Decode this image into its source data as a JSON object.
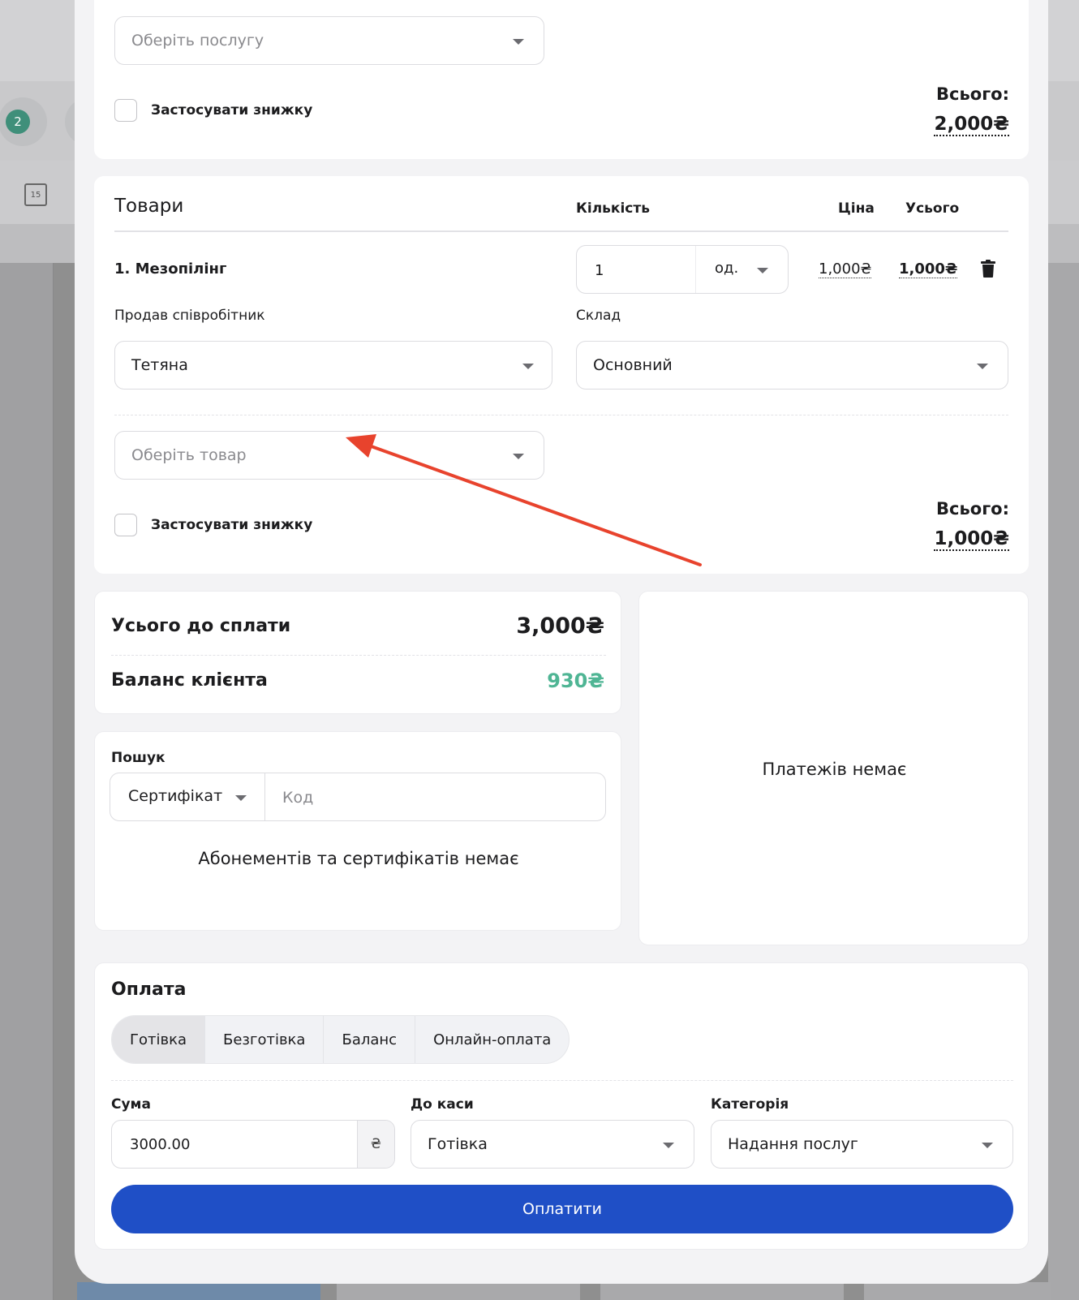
{
  "background": {
    "badge_count": "2",
    "calendar_day": "15"
  },
  "services": {
    "select_placeholder": "Оберіть послугу",
    "discount_label": "Застосувати знижку",
    "total_label": "Всього:",
    "total_value": "2,000₴"
  },
  "products": {
    "header": {
      "title": "Товари",
      "qty": "Кількість",
      "price": "Ціна",
      "total": "Усього"
    },
    "items": [
      {
        "name": "1. Мезопілінг",
        "qty": "1",
        "unit": "од.",
        "price": "1,000₴",
        "total": "1,000₴",
        "seller_label": "Продав співробітник",
        "seller": "Тетяна",
        "warehouse_label": "Склад",
        "warehouse": "Основний"
      }
    ],
    "select_placeholder": "Оберіть товар",
    "discount_label": "Застосувати знижку",
    "total_label": "Всього:",
    "total_value": "1,000₴"
  },
  "summary": {
    "to_pay_label": "Усього до сплати",
    "to_pay_value": "3,000₴",
    "balance_label": "Баланс клієнта",
    "balance_value": "930₴",
    "balance_color": "#4fb594"
  },
  "search": {
    "title": "Пошук",
    "type_value": "Сертифікат",
    "code_placeholder": "Код",
    "empty_text": "Абонементів та сертифікатів немає"
  },
  "payments": {
    "empty_text": "Платежів немає"
  },
  "payment": {
    "title": "Оплата",
    "methods": [
      "Готівка",
      "Безготівка",
      "Баланс",
      "Онлайн-оплата"
    ],
    "active_method": "Готівка",
    "amount_label": "Сума",
    "amount_value": "3000.00",
    "currency": "₴",
    "cashbox_label": "До каси",
    "cashbox_value": "Готівка",
    "category_label": "Категорія",
    "category_value": "Надання послуг",
    "pay_button": "Оплатити",
    "accent": "#1f4fc6"
  },
  "annotation": {
    "arrow_color": "#e8432d"
  }
}
